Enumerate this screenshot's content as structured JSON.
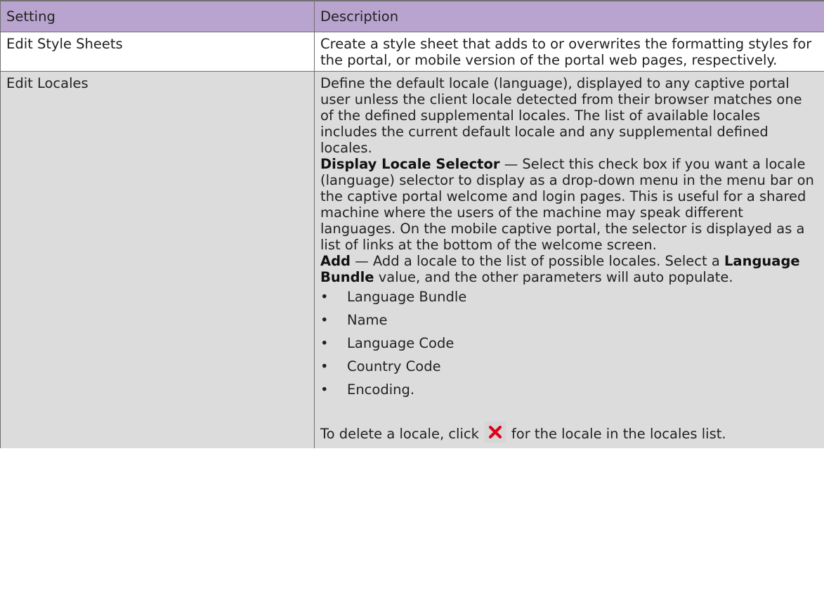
{
  "table": {
    "headers": [
      "Setting",
      "Description"
    ],
    "rows": [
      {
        "setting": "Edit Style Sheets",
        "description": "Create a style sheet that adds to or overwrites the formatting styles for the portal, or mobile version of the portal web pages, respectively."
      },
      {
        "setting": "Edit Locales",
        "intro": "Define the default locale (language), displayed to any captive portal user unless the client locale detected from their browser matches one of the defined supplemental locales. The list of available locales includes the current default locale and any supplemental defined locales.",
        "display_selector_term": "Display Locale Selector",
        "display_selector_text": " — Select this check box if you want a locale (language) selector to display as a drop-down menu in the menu bar on the captive portal welcome and login pages. This is useful for a shared machine where the users of the machine may speak different languages. On the mobile captive portal, the selector is displayed as a list of links at the bottom of the welcome screen.",
        "add_term": "Add",
        "add_text_1": " — Add a locale to the list of possible locales. Select a ",
        "add_term_2": "Language Bundle",
        "add_text_2": " value, and the other parameters will auto populate.",
        "bullets": [
          "Language Bundle",
          "Name",
          "Language Code",
          "Country Code",
          "Encoding."
        ],
        "delete_before": "To delete a locale, click",
        "delete_after": "for the locale in the locales list.",
        "delete_icon": "red-x-icon"
      }
    ]
  },
  "colors": {
    "header_bg": "#b9a4cf",
    "gray_row_bg": "#dcdcdc",
    "border": "#6f6f6f",
    "delete_icon_red": "#e0001b"
  }
}
